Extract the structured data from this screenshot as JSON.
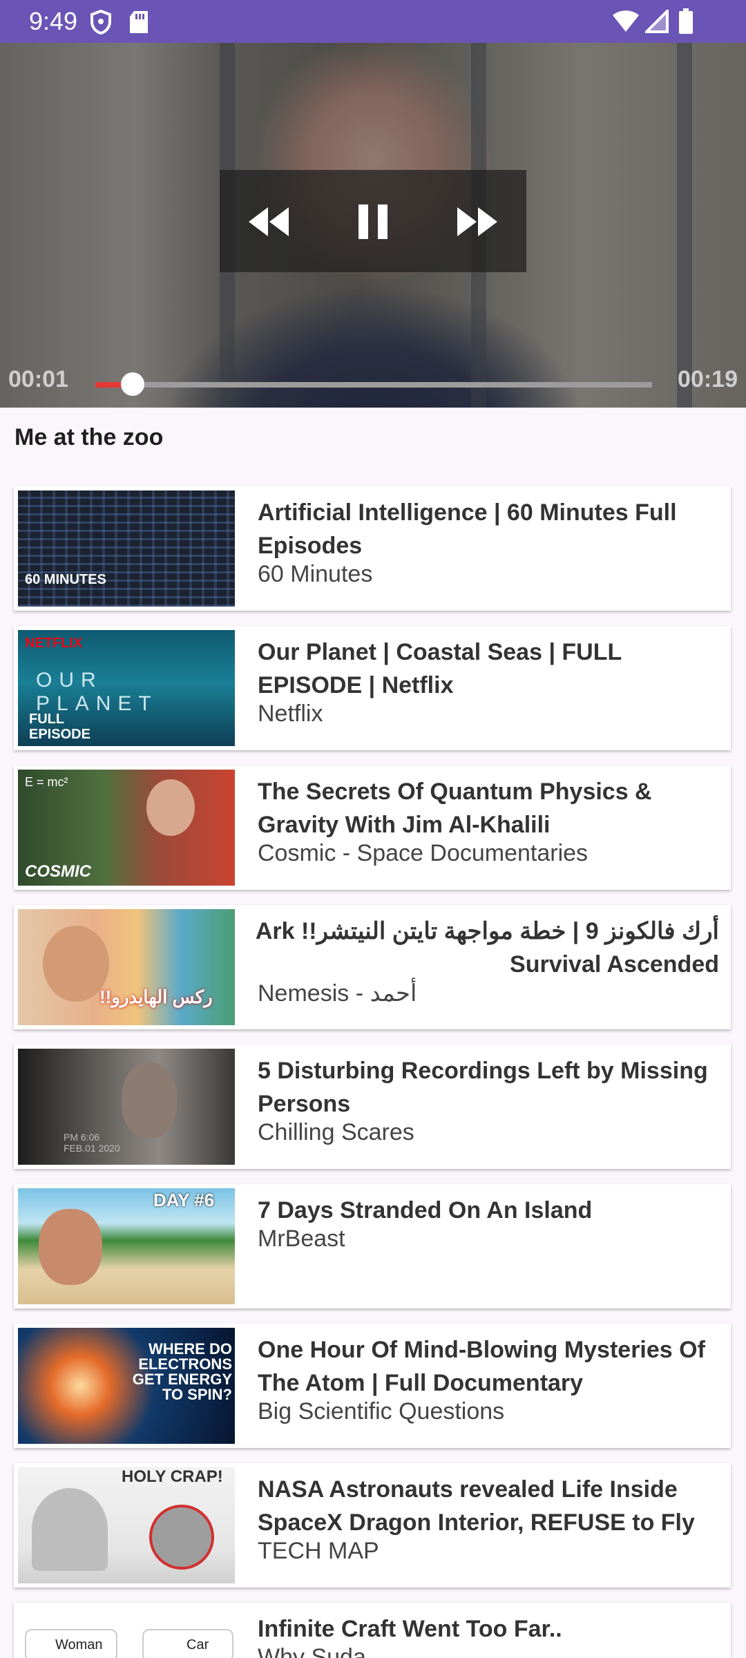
{
  "status_bar": {
    "time": "9:49"
  },
  "player": {
    "elapsed": "00:01",
    "duration": "00:19",
    "progress": 0.067
  },
  "video_title": "Me at the zoo",
  "videos": [
    {
      "title": "Artificial Intelligence | 60 Minutes Full Episodes",
      "channel": "60 Minutes",
      "thumb_text": "60 MINUTES"
    },
    {
      "title": "Our Planet | Coastal Seas | FULL EPISODE | Netflix",
      "channel": "Netflix",
      "thumb_text": "NETFLIX",
      "thumb_text2": "OUR PLANET",
      "thumb_text3": "FULL EPISODE"
    },
    {
      "title": "The Secrets Of Quantum Physics & Gravity With Jim Al-Khalili",
      "channel": "Cosmic - Space Documentaries",
      "thumb_text": "COSMIC",
      "thumb_text2": "E = mc²"
    },
    {
      "title": "أرك فالكونز 9 | خطة مواجهة تايتن النيتشر!! Ark Survival Ascended",
      "channel": "Nemesis - أحمد",
      "thumb_text": "ركس الهايدرو!!"
    },
    {
      "title": "5 Disturbing Recordings Left by Missing Persons",
      "channel": "Chilling Scares",
      "thumb_text": "PM 6:06 FEB.01 2020"
    },
    {
      "title": "7 Days Stranded On An Island",
      "channel": "MrBeast",
      "thumb_text": "DAY #6"
    },
    {
      "title": "One Hour Of Mind-Blowing Mysteries Of The Atom | Full Documentary",
      "channel": "Big Scientific Questions",
      "thumb_text": "WHERE DO ELECTRONS GET ENERGY TO SPIN?"
    },
    {
      "title": "NASA Astronauts revealed Life Inside SpaceX Dragon Interior, REFUSE to Fly …",
      "channel": "TECH MAP",
      "thumb_text": "HOLY CRAP!"
    },
    {
      "title": "Infinite Craft Went Too Far..",
      "channel": "Why Suda",
      "thumb_text": "Woman",
      "thumb_text2": "Car"
    }
  ]
}
